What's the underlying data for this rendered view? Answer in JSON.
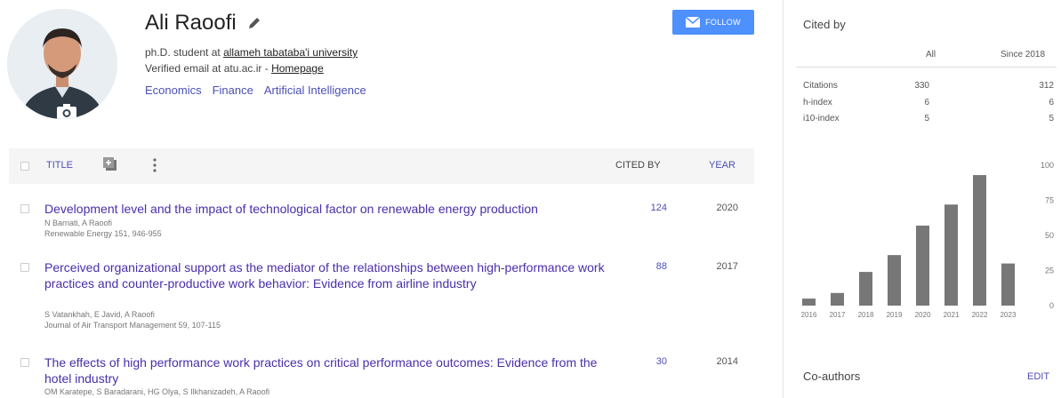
{
  "profile": {
    "name": "Ali Raoofi",
    "affiliation_prefix": "ph.D. student at ",
    "affiliation_link": "allameh tabataba'i university",
    "email_text": "Verified email at atu.ac.ir - ",
    "homepage_link": "Homepage",
    "interests": [
      "Economics",
      "Finance",
      "Artificial Intelligence"
    ],
    "follow_label": "FOLLOW"
  },
  "table": {
    "title_header": "TITLE",
    "cited_header": "CITED BY",
    "year_header": "YEAR",
    "articles": [
      {
        "title": "Development level and the impact of technological factor on renewable energy production",
        "authors": "N Barnati, A Raoofi",
        "venue": "Renewable Energy 151, 946-955",
        "cited": "124",
        "year": "2020"
      },
      {
        "title": "Perceived organizational support as the mediator of the relationships between high-performance work practices and counter-productive work behavior: Evidence from airline industry",
        "authors": "S Vatankhah, E Javid, A Raoofi",
        "venue": "Journal of Air Transport Management 59, 107-115",
        "cited": "88",
        "year": "2017"
      },
      {
        "title": "The effects of high performance work practices on critical performance outcomes: Evidence from the hotel industry",
        "authors": "OM Karatepe, S Baradarani, HG Olya, S Ilkhanizadeh, A Raoofi",
        "venue": "",
        "cited": "30",
        "year": "2014"
      }
    ]
  },
  "sidebar": {
    "cited_by": "Cited by",
    "col_all": "All",
    "col_since": "Since 2018",
    "rows": [
      {
        "label": "Citations",
        "all": "330",
        "since": "312"
      },
      {
        "label": "h-index",
        "all": "6",
        "since": "6"
      },
      {
        "label": "i10-index",
        "all": "5",
        "since": "5"
      }
    ],
    "coauthors": "Co-authors",
    "edit": "EDIT"
  },
  "chart_data": {
    "type": "bar",
    "categories": [
      "2016",
      "2017",
      "2018",
      "2019",
      "2020",
      "2021",
      "2022",
      "2023"
    ],
    "values": [
      5,
      9,
      24,
      36,
      57,
      72,
      93,
      30
    ],
    "ylim": [
      0,
      100
    ],
    "yticks": [
      "100",
      "75",
      "50",
      "25",
      "0"
    ],
    "bar_color": "#777777"
  },
  "colors": {
    "link": "#4b4fb5",
    "title": "#4b2ea8",
    "follow": "#4d90fe"
  }
}
